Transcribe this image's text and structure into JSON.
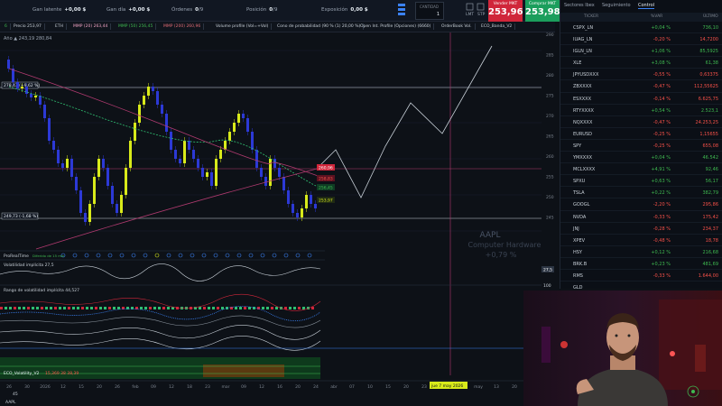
{
  "topbar": {
    "gan_latente_label": "Gan latente",
    "gan_latente_value": "+0,00 $",
    "gan_dia_label": "Gan día",
    "gan_dia_value": "+0,00 $",
    "ordenes_label": "Órdenes",
    "ordenes_value": "0",
    "ordenes_sep": "/9",
    "posicion_label": "Posición",
    "posicion_value": "0",
    "posicion_sep": "/9",
    "exposicion_label": "Exposición",
    "exposicion_value": "0,00 $",
    "qty_label": "CANTIDAD",
    "qty_value": "1",
    "lmt": "LMT",
    "stp": "STP",
    "sell_label": "Vender MKT",
    "sell_price": "253,96",
    "buy_label": "Comprar MKT",
    "buy_price": "253,98"
  },
  "toolbar": {
    "items": [
      "6",
      "Precio 253,97",
      "ETH",
      "MMP (20) 263,44",
      "MMP (50) 256,45",
      "MMP (200) 260,96",
      "Volume profile (Vol=+Vol)",
      "Cono de probabilidad (90 % (1) 20,00 %)",
      "Open Int. Profile (Opciones) (6660)",
      "OrderBook Vol.",
      "ECO_Banda_V2"
    ],
    "ohlc_line": "Año  ▲ 243,19  280,84"
  },
  "chart": {
    "price_axis": [
      "290",
      "285",
      "280",
      "275",
      "270",
      "265",
      "260",
      "255",
      "250",
      "245"
    ],
    "level_upper_label": "278,43 (+9,62 %)",
    "level_lower_label": "249,73 (-1,68 %)",
    "tag_red": "260,96",
    "tag_green": "256,45",
    "tag_yellow": "253,97",
    "tag_darkred": "258,83",
    "watermark_ticker": "AAPL",
    "watermark_name": "Computer Hardware",
    "watermark_change": "+0,79 %",
    "ind1_title": "ProRealTime",
    "ind1_note": "Diferido de 15 min",
    "ind2_title": "Volatilidad implícita 27,5",
    "ind2_tag": "27,5",
    "ind3_title": "Rango de volatilidad implícita 44,527",
    "ind3_tag_a": "100",
    "ind3_tag_b": "0",
    "ind4_title": "ECO_Volatility_V2",
    "ind4_values": "15,369  38  38,39",
    "x_axis": [
      "26",
      "30",
      "2026",
      "12",
      "15",
      "20",
      "26",
      "feb",
      "09",
      "12",
      "18",
      "23",
      "mar",
      "09",
      "12",
      "16",
      "20",
      "24",
      "abr",
      "07",
      "10",
      "15",
      "20",
      "23",
      "28",
      "30",
      "may",
      "13",
      "20",
      "jun"
    ],
    "crosshair_date": "jue 7 may 2026",
    "bottom_ticker": "AAPL",
    "bottom_zoom": "45"
  },
  "right_panel": {
    "tabs": [
      "Sectores lbex",
      "Seguimiento",
      "Control"
    ],
    "columns": [
      "TICKER",
      "%VAR",
      "ÚLTIMO"
    ],
    "rows": [
      {
        "ticker": "CSPX_LN",
        "var": "+0,04 %",
        "last": "736,10"
      },
      {
        "ticker": "IUAG_LN",
        "var": "-0,20 %",
        "last": "14,7200"
      },
      {
        "ticker": "IGLN_LN",
        "var": "+1,06 %",
        "last": "85,5925"
      },
      {
        "ticker": "XLE",
        "var": "+3,08 %",
        "last": "61,38"
      },
      {
        "ticker": "JPYUSDXXX",
        "var": "-0,55 %",
        "last": "0,63375"
      },
      {
        "ticker": "ZBXXXX",
        "var": "-0,47 %",
        "last": "112,55625"
      },
      {
        "ticker": "ESXXXX",
        "var": "-0,14 %",
        "last": "6.625,75"
      },
      {
        "ticker": "RTYXXXX",
        "var": "+0,54 %",
        "last": "2.523,1"
      },
      {
        "ticker": "NQXXXX",
        "var": "-0,47 %",
        "last": "24.253,25"
      },
      {
        "ticker": "EURUSD",
        "var": "-0,25 %",
        "last": "1,15655"
      },
      {
        "ticker": "SPY",
        "var": "-0,25 %",
        "last": "655,08"
      },
      {
        "ticker": "YMXXXX",
        "var": "+0,04 %",
        "last": "46.542"
      },
      {
        "ticker": "MCLXXXX",
        "var": "+4,91 %",
        "last": "92,46"
      },
      {
        "ticker": "SPXU",
        "var": "+0,63 %",
        "last": "56,17"
      },
      {
        "ticker": "TSLA",
        "var": "+0,22 %",
        "last": "382,79"
      },
      {
        "ticker": "GOOGL",
        "var": "-2,20 %",
        "last": "295,86"
      },
      {
        "ticker": "NVDA",
        "var": "-0,33 %",
        "last": "175,42"
      },
      {
        "ticker": "JNJ",
        "var": "-0,28 %",
        "last": "234,37"
      },
      {
        "ticker": "XPEV",
        "var": "-0,48 %",
        "last": "18,78"
      },
      {
        "ticker": "HSY",
        "var": "+0,12 %",
        "last": "216,68"
      },
      {
        "ticker": "BRK.B",
        "var": "+0,23 %",
        "last": "481,69"
      },
      {
        "ticker": "RMS",
        "var": "-0,33 %",
        "last": "1.644,00"
      },
      {
        "ticker": "GLD",
        "var": "",
        "last": ""
      }
    ]
  },
  "colors": {
    "up": "#d8ea1a",
    "down": "#2c39d6",
    "ma_fast": "#2fbf71",
    "ma_slow": "#b03a6f",
    "sell": "#d0263a",
    "buy": "#1b9e5c"
  }
}
